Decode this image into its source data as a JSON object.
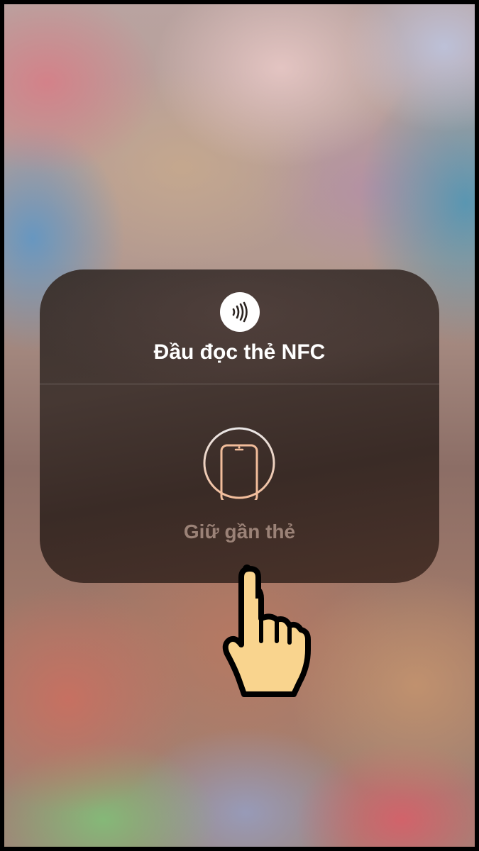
{
  "nfc_sheet": {
    "icon": "nfc-contactless-icon",
    "title": "Đầu đọc thẻ NFC",
    "phone_icon": "phone-outline-icon",
    "hint": "Giữ gần thẻ"
  },
  "overlay": {
    "pointer_icon": "hand-pointer-icon"
  },
  "colors": {
    "accent_ring": "#f2bd9b",
    "hint_text": "#9b8277",
    "hand_fill": "#f9d48e"
  }
}
